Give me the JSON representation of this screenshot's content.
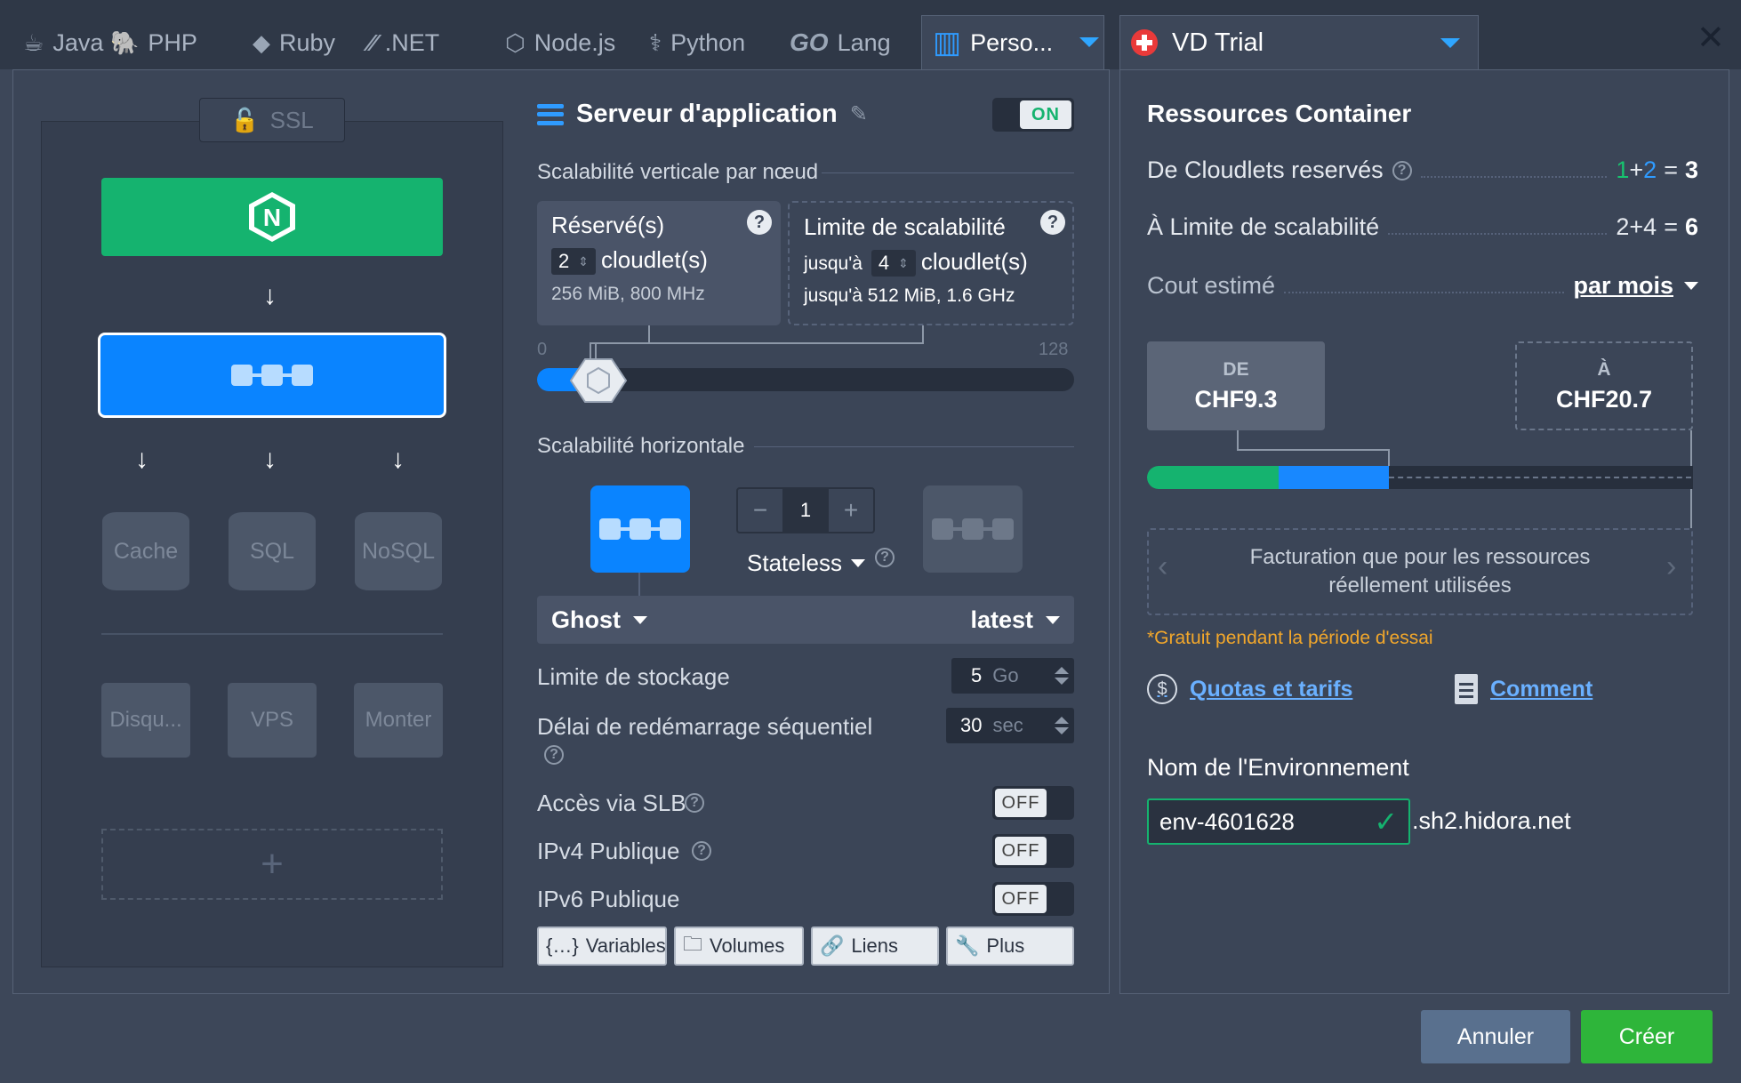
{
  "tabs": [
    {
      "label": "Java",
      "icon": "java-icon",
      "glyph": "☕"
    },
    {
      "label": "PHP",
      "icon": "php-elephant-icon",
      "glyph": "🐘"
    },
    {
      "label": "Ruby",
      "icon": "ruby-icon",
      "glyph": "◆"
    },
    {
      "label": ".NET",
      "icon": "dotnet-icon",
      "glyph": "⁄⁄"
    },
    {
      "label": "Node.js",
      "icon": "nodejs-icon",
      "glyph": "⬡"
    },
    {
      "label": "Python",
      "icon": "python-icon",
      "glyph": "⚕"
    },
    {
      "label": "Lang",
      "icon": "golang-icon",
      "glyph": "GO"
    },
    {
      "label": "Perso...",
      "icon": "custom-container-icon",
      "glyph": "▥"
    }
  ],
  "region": {
    "label": "VD Trial"
  },
  "close_glyph": "✕",
  "topology": {
    "ssl": "SSL",
    "cache": "Cache",
    "sql": "SQL",
    "nosql": "NoSQL",
    "storage": "Disqu...",
    "vps": "VPS",
    "build": "Monter",
    "add": "+",
    "nginx_letter": "N",
    "arrow": "↓"
  },
  "config": {
    "title": "Serveur d'application",
    "edit_glyph": "✎",
    "on": "ON",
    "vertical": "Scalabilité verticale par nœud",
    "reserved": {
      "title": "Réservé(s)",
      "value": "2",
      "unit": "cloudlet(s)",
      "spec": "256 MiB, 800 MHz"
    },
    "limit": {
      "title": "Limite de scalabilité",
      "prefix": "jusqu'à",
      "value": "4",
      "unit": "cloudlet(s)",
      "spec": "jusqu'à 512 MiB, 1.6 GHz"
    },
    "slider_min": "0",
    "slider_max": "128",
    "horizontal": "Scalabilité horizontale",
    "count": "1",
    "minus": "−",
    "plus": "+",
    "mode": "Stateless",
    "image": "Ghost",
    "tag": "latest",
    "storage_label": "Limite de stockage",
    "storage_value": "5",
    "storage_unit": "Go",
    "restart_label": "Délai de redémarrage séquentiel",
    "restart_value": "30",
    "restart_unit": "sec",
    "slb_label": "Accès via SLB",
    "ipv4_label": "IPv4 Publique",
    "ipv6_label": "IPv6 Publique",
    "off": "OFF",
    "buttons": [
      {
        "label": "Variables",
        "glyph": "{…}"
      },
      {
        "label": "Volumes",
        "glyph": "🗀"
      },
      {
        "label": "Liens",
        "glyph": "🔗"
      },
      {
        "label": "Plus",
        "glyph": "🔧"
      }
    ],
    "qm": "?"
  },
  "resources": {
    "title": "Ressources Container",
    "cloudlets_label": "De Cloudlets reservés",
    "c1": "1",
    "c_plus": "+",
    "c2": "2",
    "c_eq": "=",
    "c_total": "3",
    "limit_label": "À Limite de scalabilité",
    "l1": "2",
    "l2": "4",
    "l_total": "6",
    "cost_label": "Cout estimé",
    "period": "par mois",
    "from_label": "DE",
    "from_value": "CHF9.3",
    "to_label": "À",
    "to_value": "CHF20.7",
    "info": "Facturation que pour les ressources réellement utilisées",
    "free": "*Gratuit pendant la période d'essai",
    "quotas": "Quotas et tarifs",
    "how": "Comment",
    "dollar": "$",
    "chev_left": "‹",
    "chev_right": "›"
  },
  "env": {
    "label": "Nom de l'Environnement",
    "value": "env-4601628",
    "domain": ".sh2.hidora.net",
    "check": "✓"
  },
  "footer": {
    "cancel": "Annuler",
    "create": "Créer"
  },
  "colors": {
    "accent": "#0a84ff",
    "green": "#15b36f",
    "warning": "#f2a72b"
  }
}
